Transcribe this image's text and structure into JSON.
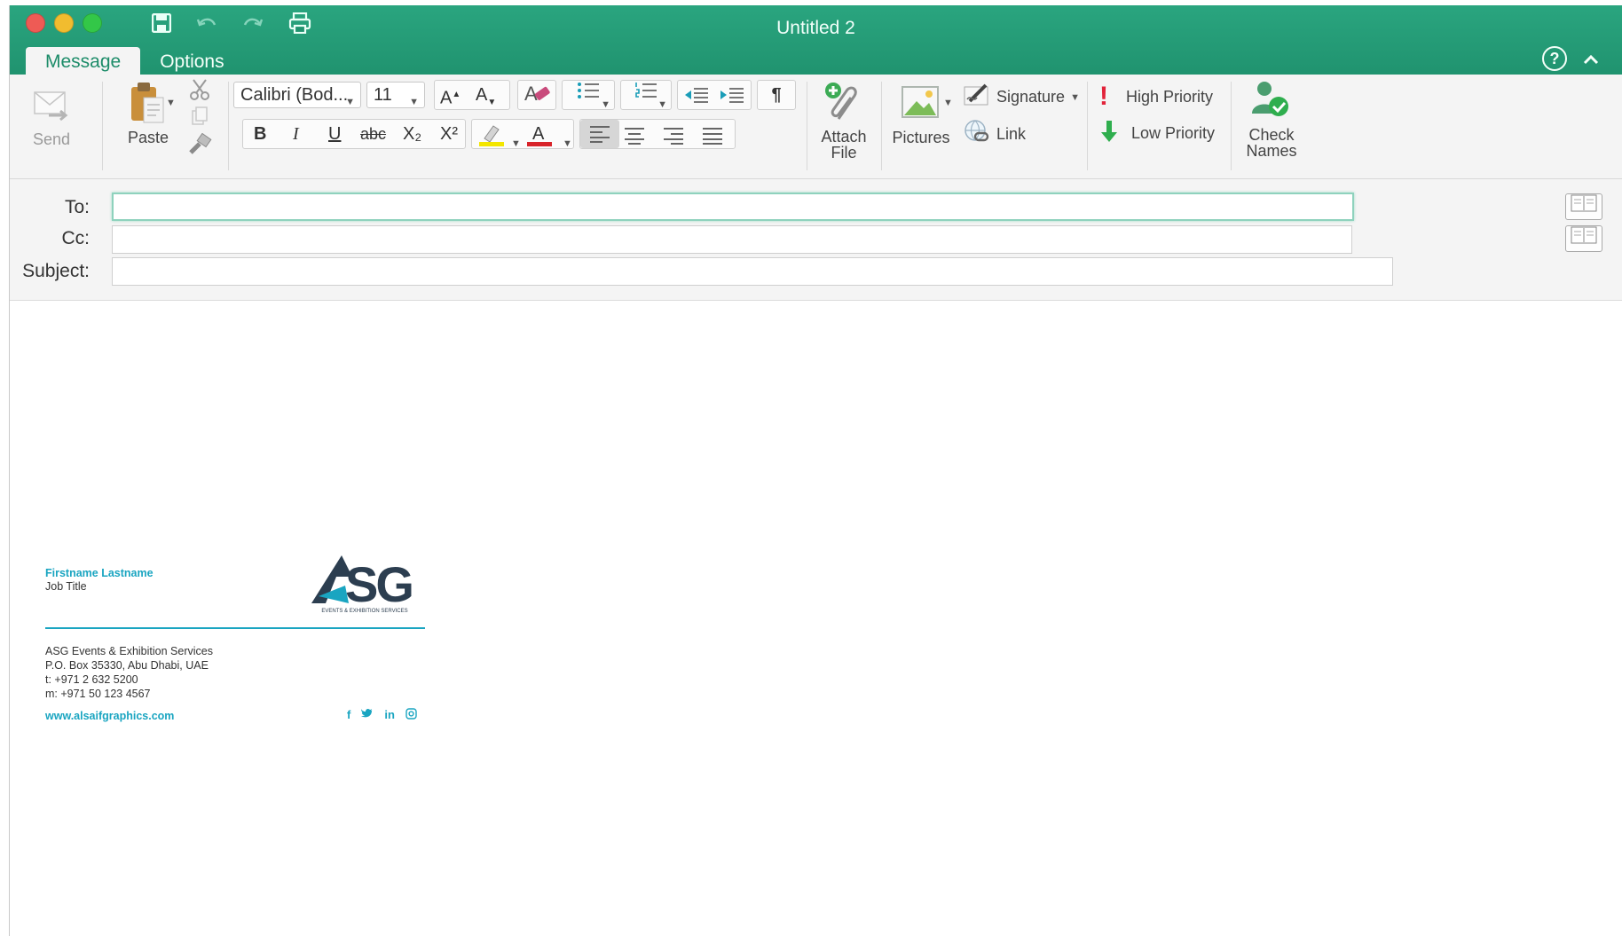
{
  "window": {
    "title": "Untitled 2"
  },
  "tabs": [
    {
      "label": "Message"
    },
    {
      "label": "Options"
    }
  ],
  "ribbon": {
    "send_label": "Send",
    "paste_label": "Paste",
    "font_name": "Calibri (Bod...",
    "font_size": "11",
    "bold": "B",
    "italic": "I",
    "underline": "U",
    "strike": "abc",
    "subscript": "X₂",
    "superscript": "X²",
    "font_color_letter": "A",
    "grow_font": "A",
    "shrink_font": "A",
    "pilcrow": "¶",
    "attach_label_1": "Attach",
    "attach_label_2": "File",
    "pictures_label": "Pictures",
    "signature_label": "Signature",
    "link_label": "Link",
    "high_priority_label": "High Priority",
    "low_priority_label": "Low Priority",
    "check_names_1": "Check",
    "check_names_2": "Names"
  },
  "fields": {
    "to_label": "To:",
    "cc_label": "Cc:",
    "subject_label": "Subject:",
    "to_value": "",
    "cc_value": "",
    "subject_value": ""
  },
  "signature": {
    "name": "Firstname Lastname",
    "job_title": "Job Title",
    "logo_text": "ASG",
    "logo_subtext": "EVENTS & EXHIBITION SERVICES",
    "company": "ASG Events & Exhibition Services",
    "address": "P.O. Box 35330, Abu Dhabi, UAE",
    "phone": "t: +971 2 632 5200",
    "mobile": "m: +971 50 123 4567",
    "website": "www.alsaifgraphics.com",
    "social": [
      "f",
      "t",
      "in",
      "ig"
    ]
  },
  "colors": {
    "title_bar": "#20936f",
    "accent_teal": "#1aa5c1",
    "high_priority": "#e2233a",
    "low_priority": "#2fae4e"
  }
}
